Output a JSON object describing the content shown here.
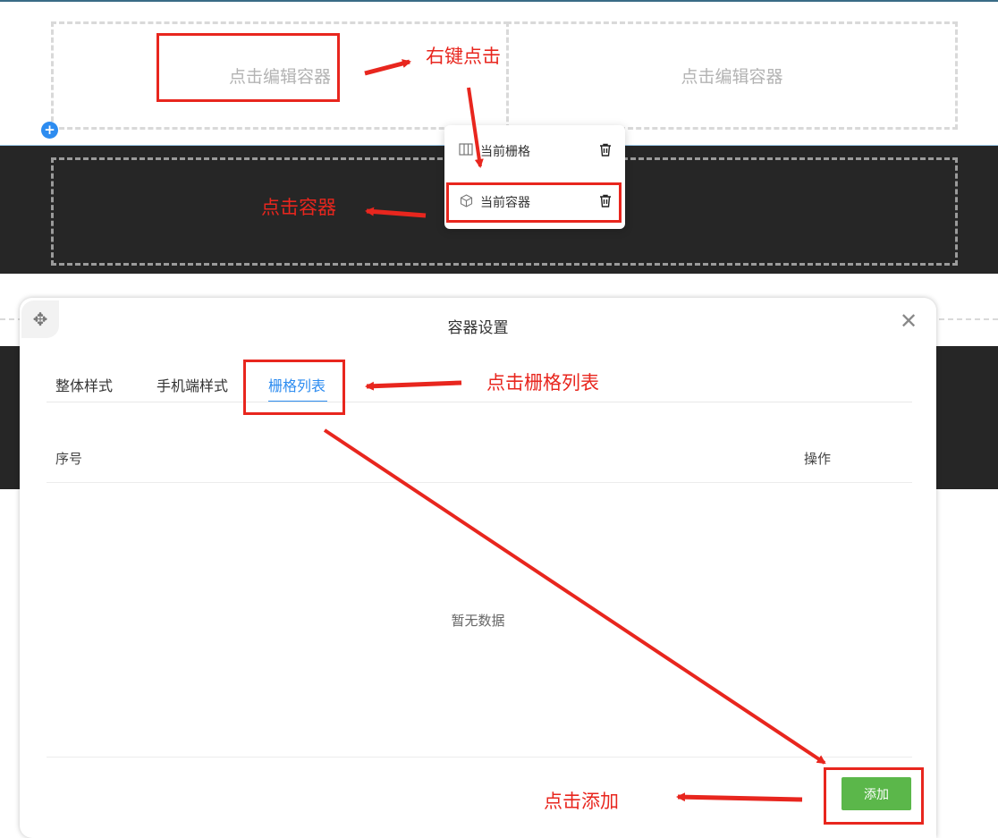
{
  "editor": {
    "cell_left_text": "点击编辑容器",
    "cell_right_text": "点击编辑容器",
    "add_symbol": "+"
  },
  "context_menu": {
    "items": [
      {
        "label": "当前栅格",
        "icon": "columns-icon"
      },
      {
        "label": "当前容器",
        "icon": "cube-icon"
      }
    ],
    "delete_icon": "trash-icon"
  },
  "dialog": {
    "title": "容器设置",
    "close_glyph": "✕",
    "move_glyph": "✥",
    "tabs": [
      {
        "label": "整体样式",
        "active": false
      },
      {
        "label": "手机端样式",
        "active": false
      },
      {
        "label": "栅格列表",
        "active": true
      }
    ],
    "table": {
      "headers": [
        "序号",
        "操作"
      ],
      "empty_text": "暂无数据"
    },
    "add_button_label": "添加"
  },
  "annotations": {
    "right_click": "右键点击",
    "click_container": "点击容器",
    "click_grid_list": "点击栅格列表",
    "click_add": "点击添加"
  },
  "colors": {
    "accent_blue": "#2d8cf0",
    "annotation_red": "#e8261e",
    "add_green": "#5bb74a",
    "dark_band": "#262626"
  }
}
